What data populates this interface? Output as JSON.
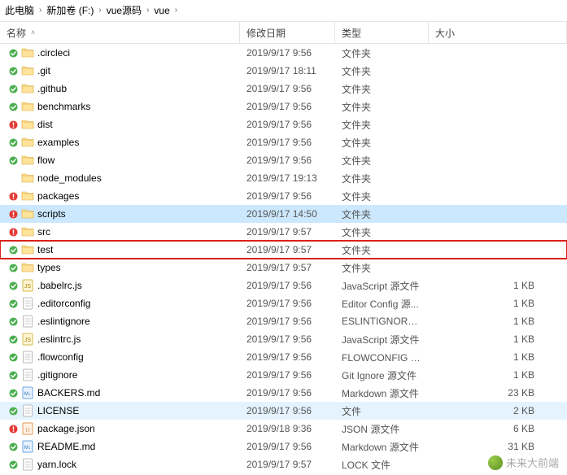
{
  "breadcrumb": {
    "root": "此电脑",
    "parts": [
      "新加卷 (F:)",
      "vue源码",
      "vue"
    ]
  },
  "headers": {
    "name": "名称",
    "date": "修改日期",
    "type": "类型",
    "size": "大小"
  },
  "rows": [
    {
      "mark": "green",
      "icon": "folder",
      "name": ".circleci",
      "date": "2019/9/17 9:56",
      "type": "文件夹",
      "size": ""
    },
    {
      "mark": "green",
      "icon": "folder",
      "name": ".git",
      "date": "2019/9/17 18:11",
      "type": "文件夹",
      "size": ""
    },
    {
      "mark": "green",
      "icon": "folder",
      "name": ".github",
      "date": "2019/9/17 9:56",
      "type": "文件夹",
      "size": ""
    },
    {
      "mark": "green",
      "icon": "folder",
      "name": "benchmarks",
      "date": "2019/9/17 9:56",
      "type": "文件夹",
      "size": ""
    },
    {
      "mark": "red",
      "icon": "folder",
      "name": "dist",
      "date": "2019/9/17 9:56",
      "type": "文件夹",
      "size": ""
    },
    {
      "mark": "green",
      "icon": "folder",
      "name": "examples",
      "date": "2019/9/17 9:56",
      "type": "文件夹",
      "size": ""
    },
    {
      "mark": "green",
      "icon": "folder",
      "name": "flow",
      "date": "2019/9/17 9:56",
      "type": "文件夹",
      "size": ""
    },
    {
      "mark": "none",
      "icon": "folder",
      "name": "node_modules",
      "date": "2019/9/17 19:13",
      "type": "文件夹",
      "size": ""
    },
    {
      "mark": "red",
      "icon": "folder",
      "name": "packages",
      "date": "2019/9/17 9:56",
      "type": "文件夹",
      "size": ""
    },
    {
      "mark": "red",
      "icon": "folder",
      "name": "scripts",
      "date": "2019/9/17 14:50",
      "type": "文件夹",
      "size": "",
      "state": "selected"
    },
    {
      "mark": "red",
      "icon": "folder",
      "name": "src",
      "date": "2019/9/17 9:57",
      "type": "文件夹",
      "size": ""
    },
    {
      "mark": "green",
      "icon": "folder",
      "name": "test",
      "date": "2019/9/17 9:57",
      "type": "文件夹",
      "size": "",
      "state": "redbox"
    },
    {
      "mark": "green",
      "icon": "folder",
      "name": "types",
      "date": "2019/9/17 9:57",
      "type": "文件夹",
      "size": ""
    },
    {
      "mark": "green",
      "icon": "js",
      "name": ".babelrc.js",
      "date": "2019/9/17 9:56",
      "type": "JavaScript 源文件",
      "size": "1 KB"
    },
    {
      "mark": "green",
      "icon": "file",
      "name": ".editorconfig",
      "date": "2019/9/17 9:56",
      "type": "Editor Config 源...",
      "size": "1 KB"
    },
    {
      "mark": "green",
      "icon": "file",
      "name": ".eslintignore",
      "date": "2019/9/17 9:56",
      "type": "ESLINTIGNORE ...",
      "size": "1 KB"
    },
    {
      "mark": "green",
      "icon": "js",
      "name": ".eslintrc.js",
      "date": "2019/9/17 9:56",
      "type": "JavaScript 源文件",
      "size": "1 KB"
    },
    {
      "mark": "green",
      "icon": "file",
      "name": ".flowconfig",
      "date": "2019/9/17 9:56",
      "type": "FLOWCONFIG 文...",
      "size": "1 KB"
    },
    {
      "mark": "green",
      "icon": "file",
      "name": ".gitignore",
      "date": "2019/9/17 9:56",
      "type": "Git Ignore 源文件",
      "size": "1 KB"
    },
    {
      "mark": "green",
      "icon": "md",
      "name": "BACKERS.md",
      "date": "2019/9/17 9:56",
      "type": "Markdown 源文件",
      "size": "23 KB"
    },
    {
      "mark": "green",
      "icon": "file",
      "name": "LICENSE",
      "date": "2019/9/17 9:56",
      "type": "文件",
      "size": "2 KB",
      "state": "light"
    },
    {
      "mark": "red",
      "icon": "json",
      "name": "package.json",
      "date": "2019/9/18 9:36",
      "type": "JSON 源文件",
      "size": "6 KB"
    },
    {
      "mark": "green",
      "icon": "md",
      "name": "README.md",
      "date": "2019/9/17 9:56",
      "type": "Markdown 源文件",
      "size": "31 KB"
    },
    {
      "mark": "green",
      "icon": "file",
      "name": "yarn.lock",
      "date": "2019/9/17 9:57",
      "type": "LOCK 文件",
      "size": ""
    }
  ],
  "watermark": "未来大前端"
}
